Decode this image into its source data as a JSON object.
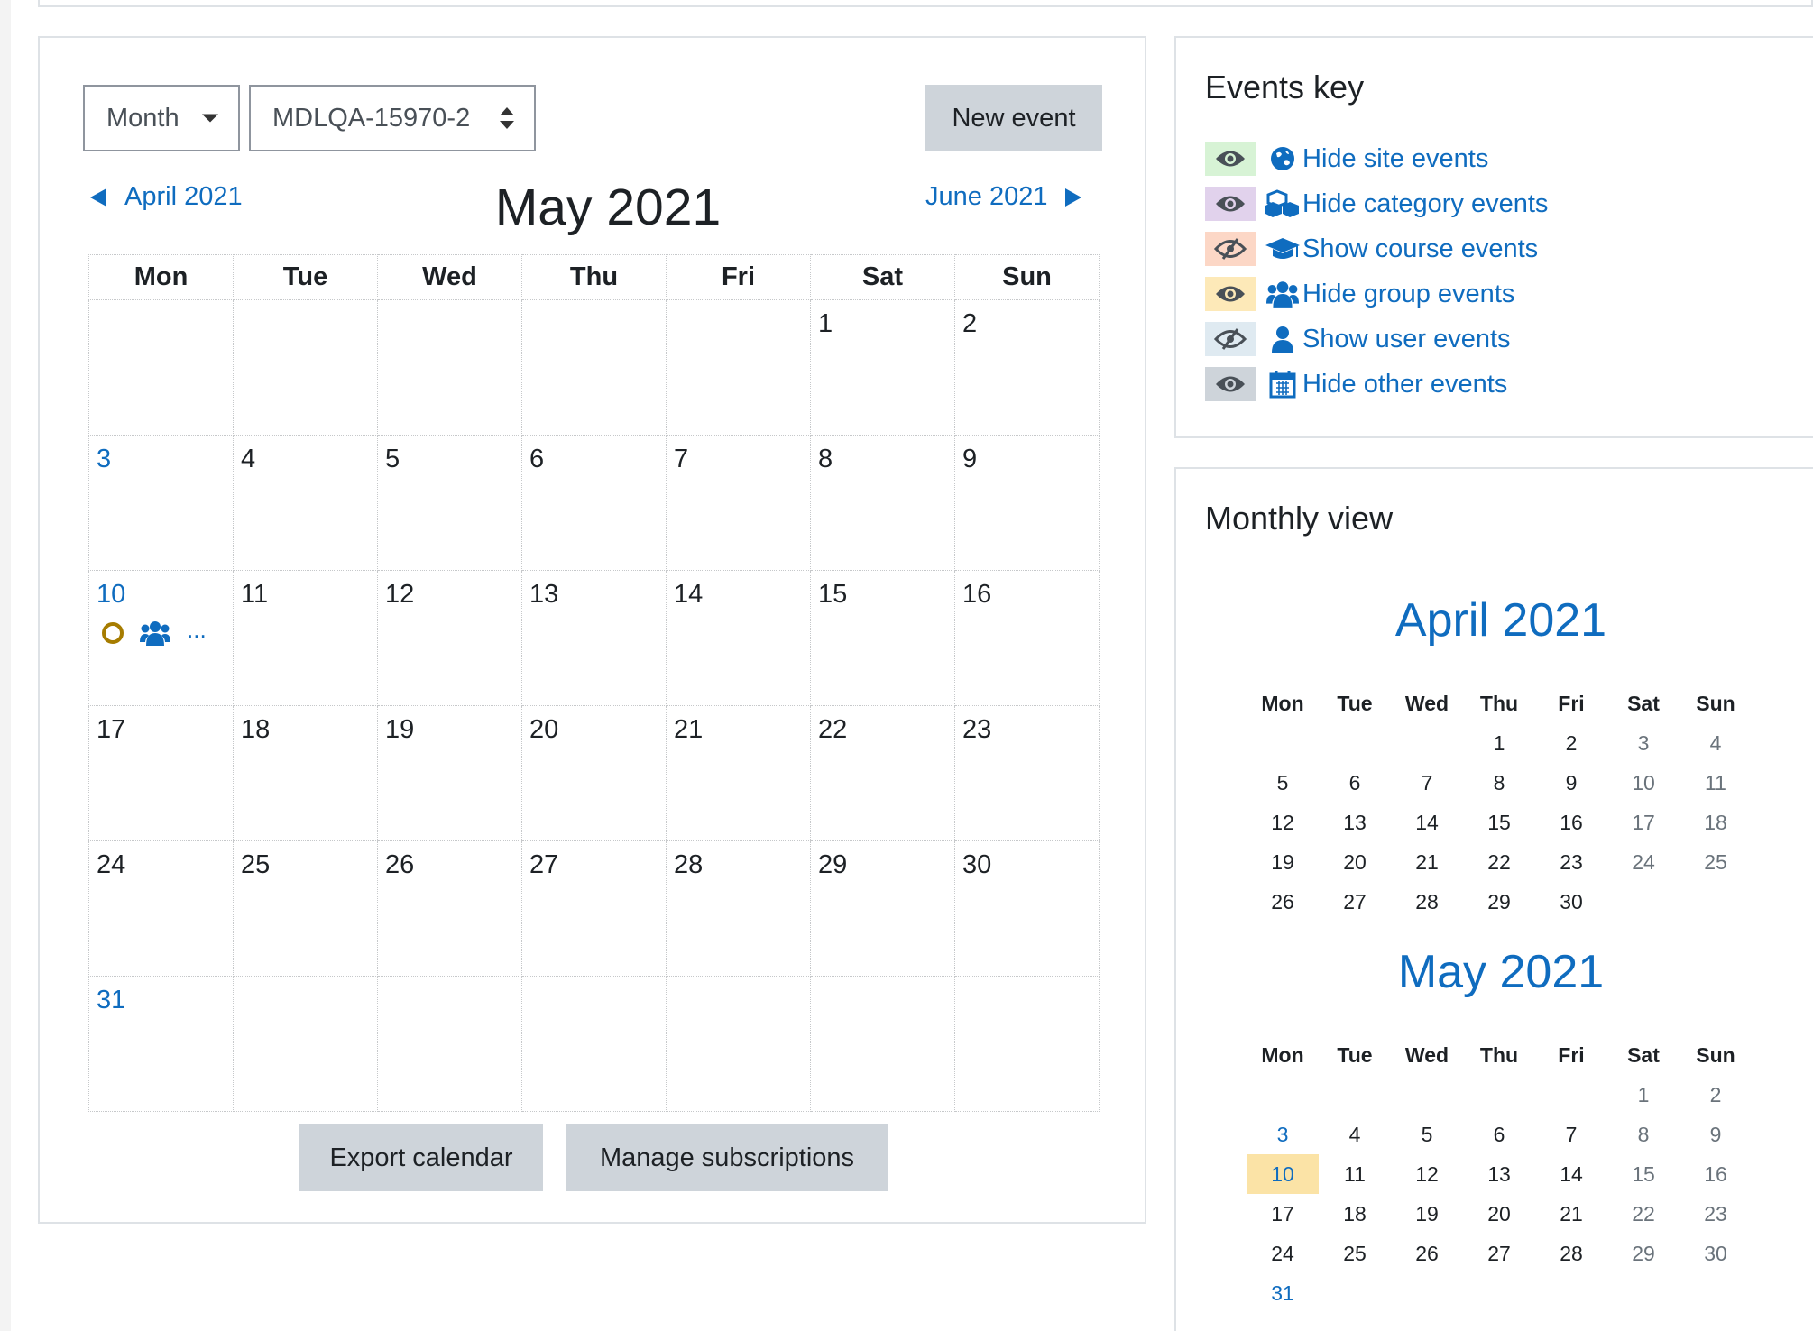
{
  "toolbar": {
    "view_select": "Month",
    "course_select": "MDLQA-15970-2",
    "new_event": "New event"
  },
  "nav": {
    "prev": "April 2021",
    "current": "May 2021",
    "next": "June 2021"
  },
  "calendar": {
    "weekdays": [
      "Mon",
      "Tue",
      "Wed",
      "Thu",
      "Fri",
      "Sat",
      "Sun"
    ],
    "weeks": [
      [
        "",
        "",
        "",
        "",
        "",
        "1",
        "2"
      ],
      [
        "3",
        "4",
        "5",
        "6",
        "7",
        "8",
        "9"
      ],
      [
        "10",
        "11",
        "12",
        "13",
        "14",
        "15",
        "16"
      ],
      [
        "17",
        "18",
        "19",
        "20",
        "21",
        "22",
        "23"
      ],
      [
        "24",
        "25",
        "26",
        "27",
        "28",
        "29",
        "30"
      ],
      [
        "31",
        "",
        "",
        "",
        "",
        "",
        ""
      ]
    ],
    "more_events": "..."
  },
  "footer": {
    "export": "Export calendar",
    "manage": "Manage subscriptions"
  },
  "events_key": {
    "title": "Events key",
    "items": [
      {
        "label": "Hide site events",
        "icon": "globe-icon",
        "eye": "eye-icon",
        "bg": "#d7f3d5"
      },
      {
        "label": "Hide category events",
        "icon": "cubes-icon",
        "eye": "eye-icon",
        "bg": "#e1d2ec"
      },
      {
        "label": "Show course events",
        "icon": "graduation-cap-icon",
        "eye": "eye-slash-icon",
        "bg": "#fcd7c6"
      },
      {
        "label": "Hide group events",
        "icon": "users-icon",
        "eye": "eye-icon",
        "bg": "#fde9b8"
      },
      {
        "label": "Show user events",
        "icon": "user-icon",
        "eye": "eye-slash-icon",
        "bg": "#dfeaf1"
      },
      {
        "label": "Hide other events",
        "icon": "calendar-icon",
        "eye": "eye-icon",
        "bg": "#ced4da"
      }
    ]
  },
  "monthly_view": {
    "title": "Monthly view",
    "weekdays": [
      "Mon",
      "Tue",
      "Wed",
      "Thu",
      "Fri",
      "Sat",
      "Sun"
    ],
    "april": {
      "title": "April 2021",
      "weeks": [
        [
          "",
          "",
          "",
          "1",
          "2",
          "3",
          "4"
        ],
        [
          "5",
          "6",
          "7",
          "8",
          "9",
          "10",
          "11"
        ],
        [
          "12",
          "13",
          "14",
          "15",
          "16",
          "17",
          "18"
        ],
        [
          "19",
          "20",
          "21",
          "22",
          "23",
          "24",
          "25"
        ],
        [
          "26",
          "27",
          "28",
          "29",
          "30",
          "",
          ""
        ]
      ]
    },
    "may": {
      "title": "May 2021",
      "weeks": [
        [
          "",
          "",
          "",
          "",
          "",
          "1",
          "2"
        ],
        [
          "3",
          "4",
          "5",
          "6",
          "7",
          "8",
          "9"
        ],
        [
          "10",
          "11",
          "12",
          "13",
          "14",
          "15",
          "16"
        ],
        [
          "17",
          "18",
          "19",
          "20",
          "21",
          "22",
          "23"
        ],
        [
          "24",
          "25",
          "26",
          "27",
          "28",
          "29",
          "30"
        ],
        [
          "31",
          "",
          "",
          "",
          "",
          "",
          ""
        ]
      ]
    }
  }
}
